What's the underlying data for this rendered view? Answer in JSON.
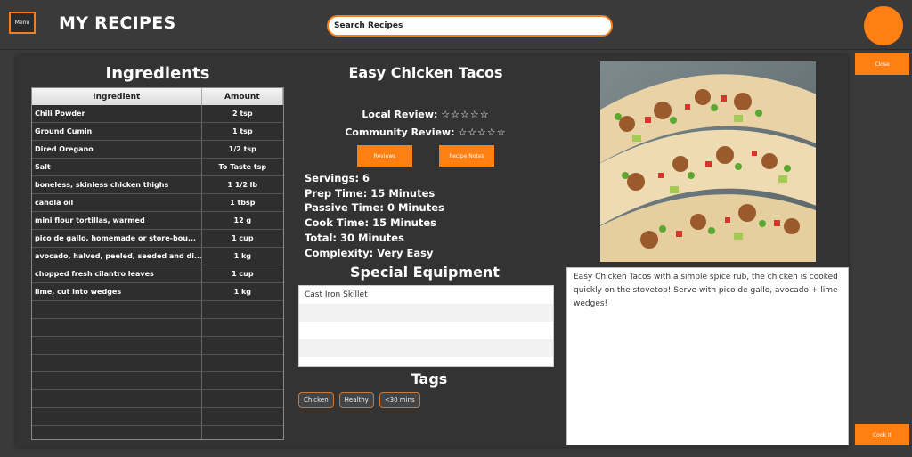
{
  "header": {
    "menu_label": "Menu",
    "title": "MY RECIPES",
    "search_placeholder": "Search Recipes"
  },
  "colors": {
    "accent": "#ff7f13",
    "background": "#3a3a3a",
    "panel": "#333333"
  },
  "ingredients": {
    "title": "Ingredients",
    "columns": [
      "Ingredient",
      "Amount"
    ],
    "rows": [
      [
        "Chili Powder",
        "2 tsp"
      ],
      [
        "Ground Cumin",
        "1 tsp"
      ],
      [
        "Dired Oregano",
        "1/2 tsp"
      ],
      [
        "Salt",
        "To Taste tsp"
      ],
      [
        "boneless, skinless chicken thighs",
        "1 1/2 lb"
      ],
      [
        "canola oil",
        "1 tbsp"
      ],
      [
        "mini flour tortillas, warmed",
        "12 g"
      ],
      [
        "pico de gallo, homemade or store-bou...",
        "1 cup"
      ],
      [
        "avocado, halved, peeled, seeded and di...",
        "1 kg"
      ],
      [
        "chopped fresh cilantro leaves",
        "1 cup"
      ],
      [
        "lime, cut into wedges",
        "1 kg"
      ],
      [
        "",
        ""
      ],
      [
        "",
        ""
      ],
      [
        "",
        ""
      ],
      [
        "",
        ""
      ],
      [
        "",
        ""
      ],
      [
        "",
        ""
      ],
      [
        "",
        ""
      ],
      [
        "",
        ""
      ]
    ]
  },
  "recipe": {
    "title": "Easy Chicken Tacos",
    "local_review_label": "Local Review:",
    "local_review_stars": "☆☆☆☆☆",
    "community_review_label": "Community Review:",
    "community_review_stars": "☆☆☆☆☆",
    "reviews_button": "Reviews",
    "notes_button": "Recipe Notes",
    "servings": "Servings: 6",
    "prep_time": "Prep Time: 15 Minutes",
    "passive_time": "Passive Time: 0 Minutes",
    "cook_time": "Cook Time: 15 Minutes",
    "total": "Total: 30 Minutes",
    "complexity": "Complexity: Very Easy",
    "description": "Easy Chicken Tacos with a simple spice rub, the chicken is cooked quickly on the stovetop! Serve with pico de gallo, avocado + lime wedges!"
  },
  "equipment": {
    "title": "Special Equipment",
    "items": [
      "Cast Iron Skillet",
      "",
      "",
      ""
    ]
  },
  "tags": {
    "title": "Tags",
    "items": [
      "Chicken",
      "Healthy",
      "<30 mins"
    ]
  },
  "actions": {
    "close": "Close",
    "cook": "Cook It"
  }
}
